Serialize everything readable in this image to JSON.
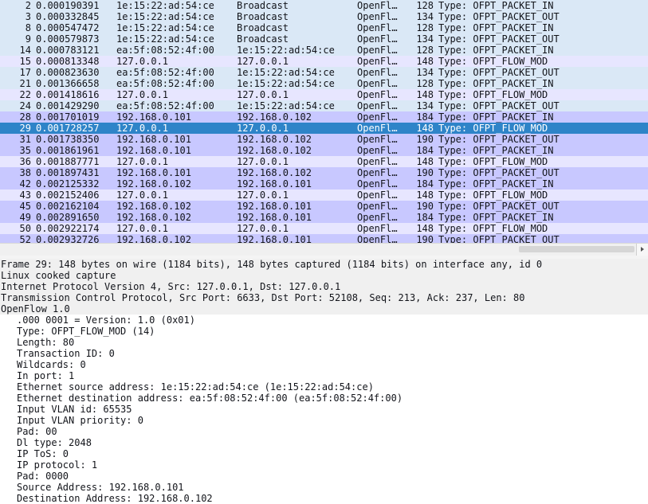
{
  "packets": [
    {
      "no": "2",
      "time": "0.000190391",
      "src": "1e:15:22:ad:54:ce",
      "dst": "Broadcast",
      "proto": "OpenFl…",
      "len": "128",
      "info": "Type: OFPT_PACKET_IN",
      "bg": "b"
    },
    {
      "no": "3",
      "time": "0.000332845",
      "src": "1e:15:22:ad:54:ce",
      "dst": "Broadcast",
      "proto": "OpenFl…",
      "len": "134",
      "info": "Type: OFPT_PACKET_OUT",
      "bg": "b"
    },
    {
      "no": "8",
      "time": "0.000547472",
      "src": "1e:15:22:ad:54:ce",
      "dst": "Broadcast",
      "proto": "OpenFl…",
      "len": "128",
      "info": "Type: OFPT_PACKET_IN",
      "bg": "b"
    },
    {
      "no": "9",
      "time": "0.000579873",
      "src": "1e:15:22:ad:54:ce",
      "dst": "Broadcast",
      "proto": "OpenFl…",
      "len": "134",
      "info": "Type: OFPT_PACKET_OUT",
      "bg": "b"
    },
    {
      "no": "14",
      "time": "0.000783121",
      "src": "ea:5f:08:52:4f:00",
      "dst": "1e:15:22:ad:54:ce",
      "proto": "OpenFl…",
      "len": "128",
      "info": "Type: OFPT_PACKET_IN",
      "bg": "b"
    },
    {
      "no": "15",
      "time": "0.000813348",
      "src": "127.0.0.1",
      "dst": "127.0.0.1",
      "proto": "OpenFl…",
      "len": "148",
      "info": "Type: OFPT_FLOW_MOD",
      "bg": "a"
    },
    {
      "no": "17",
      "time": "0.000823630",
      "src": "ea:5f:08:52:4f:00",
      "dst": "1e:15:22:ad:54:ce",
      "proto": "OpenFl…",
      "len": "134",
      "info": "Type: OFPT_PACKET_OUT",
      "bg": "b"
    },
    {
      "no": "21",
      "time": "0.001366658",
      "src": "ea:5f:08:52:4f:00",
      "dst": "1e:15:22:ad:54:ce",
      "proto": "OpenFl…",
      "len": "128",
      "info": "Type: OFPT_PACKET_IN",
      "bg": "b"
    },
    {
      "no": "22",
      "time": "0.001418616",
      "src": "127.0.0.1",
      "dst": "127.0.0.1",
      "proto": "OpenFl…",
      "len": "148",
      "info": "Type: OFPT_FLOW_MOD",
      "bg": "a"
    },
    {
      "no": "24",
      "time": "0.001429290",
      "src": "ea:5f:08:52:4f:00",
      "dst": "1e:15:22:ad:54:ce",
      "proto": "OpenFl…",
      "len": "134",
      "info": "Type: OFPT_PACKET_OUT",
      "bg": "b"
    },
    {
      "no": "28",
      "time": "0.001701019",
      "src": "192.168.0.101",
      "dst": "192.168.0.102",
      "proto": "OpenFl…",
      "len": "184",
      "info": "Type: OFPT_PACKET_IN",
      "bg": "c"
    },
    {
      "no": "29",
      "time": "0.001728257",
      "src": "127.0.0.1",
      "dst": "127.0.0.1",
      "proto": "OpenFl…",
      "len": "148",
      "info": "Type: OFPT_FLOW_MOD",
      "bg": "sel"
    },
    {
      "no": "31",
      "time": "0.001738350",
      "src": "192.168.0.101",
      "dst": "192.168.0.102",
      "proto": "OpenFl…",
      "len": "190",
      "info": "Type: OFPT_PACKET_OUT",
      "bg": "c"
    },
    {
      "no": "35",
      "time": "0.001861961",
      "src": "192.168.0.101",
      "dst": "192.168.0.102",
      "proto": "OpenFl…",
      "len": "184",
      "info": "Type: OFPT_PACKET_IN",
      "bg": "c"
    },
    {
      "no": "36",
      "time": "0.001887771",
      "src": "127.0.0.1",
      "dst": "127.0.0.1",
      "proto": "OpenFl…",
      "len": "148",
      "info": "Type: OFPT_FLOW_MOD",
      "bg": "a"
    },
    {
      "no": "38",
      "time": "0.001897431",
      "src": "192.168.0.101",
      "dst": "192.168.0.102",
      "proto": "OpenFl…",
      "len": "190",
      "info": "Type: OFPT_PACKET_OUT",
      "bg": "c"
    },
    {
      "no": "42",
      "time": "0.002125332",
      "src": "192.168.0.102",
      "dst": "192.168.0.101",
      "proto": "OpenFl…",
      "len": "184",
      "info": "Type: OFPT_PACKET_IN",
      "bg": "c"
    },
    {
      "no": "43",
      "time": "0.002152406",
      "src": "127.0.0.1",
      "dst": "127.0.0.1",
      "proto": "OpenFl…",
      "len": "148",
      "info": "Type: OFPT_FLOW_MOD",
      "bg": "a"
    },
    {
      "no": "45",
      "time": "0.002162104",
      "src": "192.168.0.102",
      "dst": "192.168.0.101",
      "proto": "OpenFl…",
      "len": "190",
      "info": "Type: OFPT_PACKET_OUT",
      "bg": "c"
    },
    {
      "no": "49",
      "time": "0.002891650",
      "src": "192.168.0.102",
      "dst": "192.168.0.101",
      "proto": "OpenFl…",
      "len": "184",
      "info": "Type: OFPT_PACKET_IN",
      "bg": "c"
    },
    {
      "no": "50",
      "time": "0.002922174",
      "src": "127.0.0.1",
      "dst": "127.0.0.1",
      "proto": "OpenFl…",
      "len": "148",
      "info": "Type: OFPT_FLOW_MOD",
      "bg": "a"
    },
    {
      "no": "52",
      "time": "0.002932726",
      "src": "192.168.0.102",
      "dst": "192.168.0.101",
      "proto": "OpenFl…",
      "len": "190",
      "info": "Type: OFPT_PACKET_OUT",
      "bg": "c"
    }
  ],
  "details": [
    {
      "text": "Frame 29: 148 bytes on wire (1184 bits), 148 bytes captured (1184 bits) on interface any, id 0",
      "level": 0
    },
    {
      "text": "Linux cooked capture",
      "level": 0
    },
    {
      "text": "Internet Protocol Version 4, Src: 127.0.0.1, Dst: 127.0.0.1",
      "level": 0
    },
    {
      "text": "Transmission Control Protocol, Src Port: 6633, Dst Port: 52108, Seq: 213, Ack: 237, Len: 80",
      "level": 0
    },
    {
      "text": "OpenFlow 1.0",
      "level": 0
    },
    {
      "text": ".000 0001 = Version: 1.0 (0x01)",
      "level": 1
    },
    {
      "text": "Type: OFPT_FLOW_MOD (14)",
      "level": 1
    },
    {
      "text": "Length: 80",
      "level": 1
    },
    {
      "text": "Transaction ID: 0",
      "level": 1
    },
    {
      "text": "Wildcards: 0",
      "level": 1
    },
    {
      "text": "In port: 1",
      "level": 1
    },
    {
      "text": "Ethernet source address: 1e:15:22:ad:54:ce (1e:15:22:ad:54:ce)",
      "level": 1
    },
    {
      "text": "Ethernet destination address: ea:5f:08:52:4f:00 (ea:5f:08:52:4f:00)",
      "level": 1
    },
    {
      "text": "Input VLAN id: 65535",
      "level": 1
    },
    {
      "text": "Input VLAN priority: 0",
      "level": 1
    },
    {
      "text": "Pad: 00",
      "level": 1
    },
    {
      "text": "Dl type: 2048",
      "level": 1
    },
    {
      "text": "IP ToS: 0",
      "level": 1
    },
    {
      "text": "IP protocol: 1",
      "level": 1
    },
    {
      "text": "Pad: 0000",
      "level": 1
    },
    {
      "text": "Source Address: 192.168.0.101",
      "level": 1
    },
    {
      "text": "Destination Address: 192.168.0.102",
      "level": 1
    }
  ],
  "colors": {
    "row_a": "#e7e6ff",
    "row_b": "#dae8f6",
    "row_c": "#c8c8ff",
    "selected": "#2e84c8"
  }
}
